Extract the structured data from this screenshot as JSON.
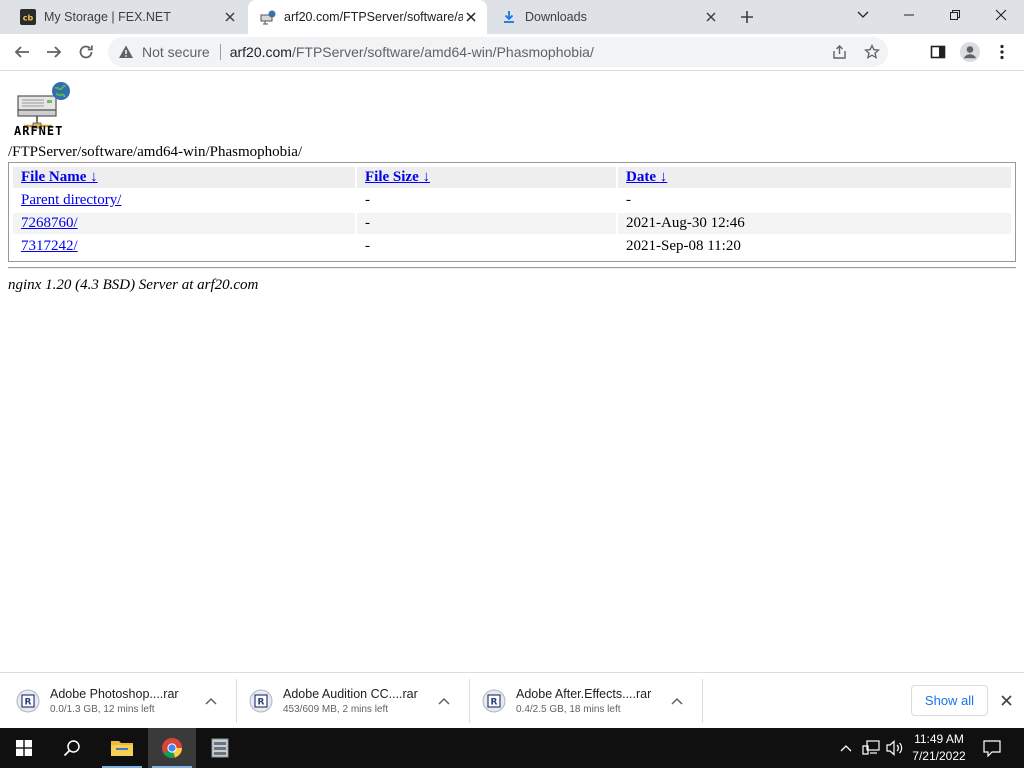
{
  "browser": {
    "tabs": [
      {
        "title": "My Storage | FEX.NET",
        "favicon": "fex-icon"
      },
      {
        "title": "arf20.com/FTPServer/software/ar",
        "favicon": "arfnet-icon"
      },
      {
        "title": "Downloads",
        "favicon": "download-icon"
      }
    ],
    "omnibox": {
      "security_label": "Not secure",
      "url_host": "arf20.com",
      "url_path": "/FTPServer/software/amd64-win/Phasmophobia/"
    }
  },
  "page": {
    "logo_text": "ARFNET",
    "path": "/FTPServer/software/amd64-win/Phasmophobia/",
    "columns": [
      {
        "label": "File Name",
        "sort_arrow": "↓"
      },
      {
        "label": "File Size",
        "sort_arrow": "↓"
      },
      {
        "label": "Date",
        "sort_arrow": "↓"
      }
    ],
    "rows": [
      {
        "name": "Parent directory/",
        "size": "-",
        "date": "-"
      },
      {
        "name": "7268760/",
        "size": "-",
        "date": "2021-Aug-30 12:46"
      },
      {
        "name": "7317242/",
        "size": "-",
        "date": "2021-Sep-08 11:20"
      }
    ],
    "footer": "nginx 1.20 (4.3 BSD) Server at arf20.com"
  },
  "downloads": {
    "items": [
      {
        "name": "Adobe Photoshop....rar",
        "status": "0.0/1.3 GB, 12 mins left"
      },
      {
        "name": "Adobe Audition CC....rar",
        "status": "453/609 MB, 2 mins left"
      },
      {
        "name": "Adobe After.Effects....rar",
        "status": "0.4/2.5 GB, 18 mins left"
      }
    ],
    "show_all_label": "Show all"
  },
  "taskbar": {
    "time": "11:49 AM",
    "date": "7/21/2022"
  },
  "colors": {
    "link": "#0000ee",
    "accent_blue": "#1a73e8",
    "tabstrip_bg": "#dee1e6",
    "taskbar_bg": "#101010"
  }
}
